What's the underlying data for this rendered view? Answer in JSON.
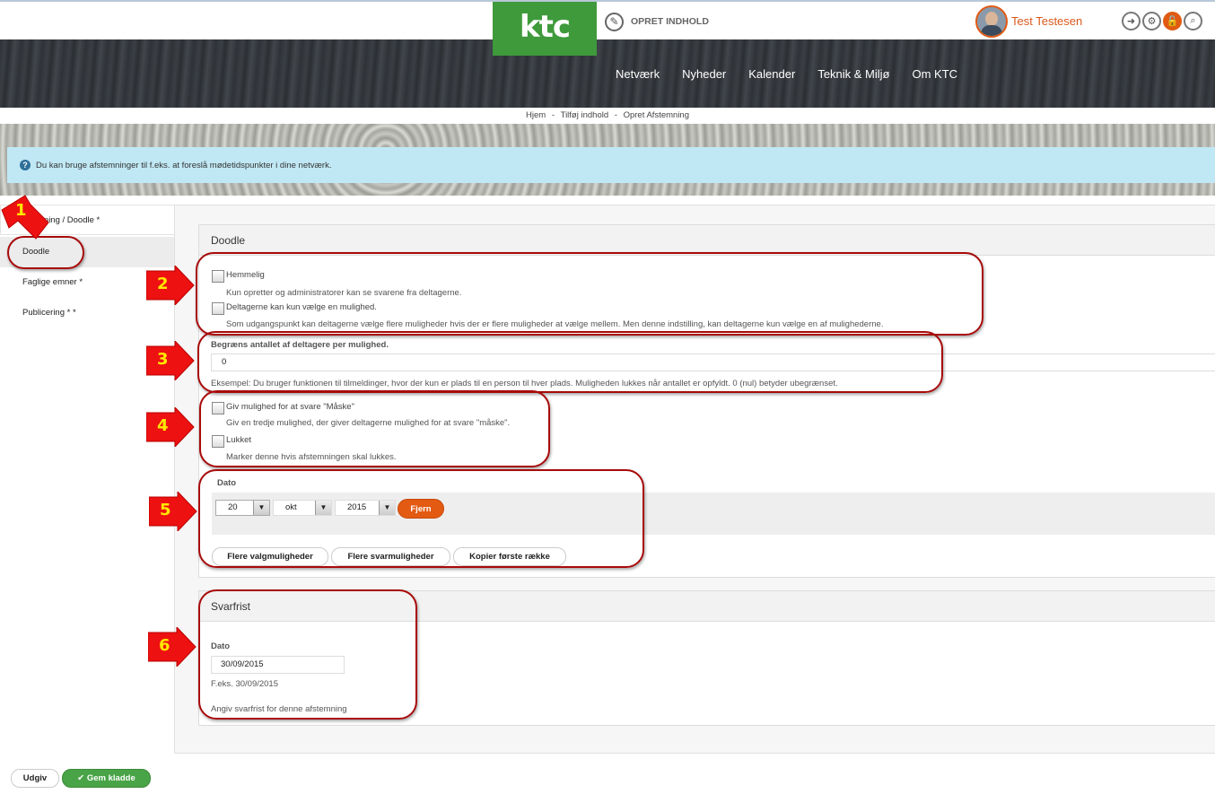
{
  "header": {
    "logo_text": "ktc",
    "create_label": "OPRET INDHOLD",
    "user_name": "Test Testesen",
    "tool_icons": [
      "arrow-icon",
      "gear-icon",
      "lock-icon",
      "search-icon"
    ]
  },
  "nav": {
    "items": [
      "Netværk",
      "Nyheder",
      "Kalender",
      "Teknik & Miljø",
      "Om KTC"
    ]
  },
  "breadcrumb": {
    "items": [
      "Hjem",
      "Tilføj indhold",
      "Opret Afstemning"
    ],
    "separator": "-"
  },
  "info": {
    "text": "Du kan bruge afstemninger til f.eks. at foreslå mødetidspunkter i dine netværk."
  },
  "tabs": [
    "mning / Doodle *",
    "Doodle",
    "Faglige emner *",
    "Publicering * *"
  ],
  "doodle": {
    "title": "Doodle",
    "secret": {
      "label": "Hemmelig",
      "checked": false,
      "description": "Kun opretter og administratorer kan se svarene fra deltagerne."
    },
    "single_choice": {
      "label": "Deltagerne kan kun vælge en mulighed.",
      "checked": false,
      "description": "Som udgangspunkt kan deltagerne vælge flere muligheder hvis der er flere muligheder at vælge mellem. Men denne indstilling, kan deltagerne kun vælge en af mulighederne."
    },
    "limit": {
      "label": "Begræns antallet af deltagere per mulighed.",
      "value": "0",
      "description": "Eksempel: Du bruger funktionen til tilmeldinger, hvor der kun er plads til en person til hver plads. Muligheden lukkes når antallet er opfyldt. 0 (nul) betyder ubegrænset."
    },
    "maybe": {
      "label": "Giv mulighed for at svare \"Måske\"",
      "checked": false,
      "description": "Giv en tredje mulighed, der giver deltagerne mulighed for at svare \"måske\"."
    },
    "closed": {
      "label": "Lukket",
      "checked": false,
      "description": "Marker denne hvis afstemningen skal lukkes."
    },
    "date": {
      "label": "Dato",
      "day": "20",
      "month": "okt",
      "year": "2015",
      "remove_label": "Fjern"
    },
    "buttons": {
      "more_options": "Flere valgmuligheder",
      "more_answers": "Flere svarmuligheder",
      "copy_first_row": "Kopier første række"
    }
  },
  "deadline": {
    "title": "Svarfrist",
    "date_label": "Dato",
    "date_value": "30/09/2015",
    "example": "F.eks. 30/09/2015",
    "description": "Angiv svarfrist for denne afstemning"
  },
  "footer": {
    "publish_label": "Udgiv",
    "save_draft_label": "Gem kladde"
  },
  "annotations": [
    "1",
    "2",
    "3",
    "4",
    "5",
    "6"
  ],
  "colors": {
    "brand_green": "#3f9a3c",
    "accent_orange": "#e35a12",
    "info_blue": "#c0e8f4",
    "annotation_red": "#a80a0a",
    "annotation_yellow": "#ffe800"
  }
}
